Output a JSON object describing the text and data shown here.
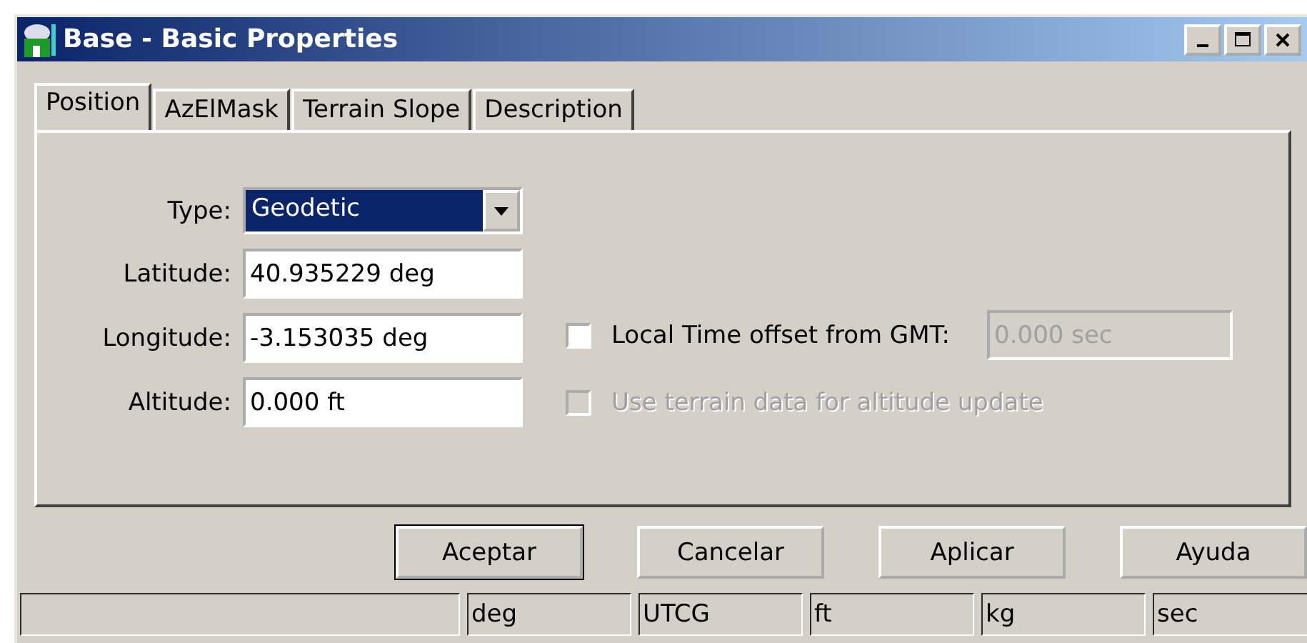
{
  "window": {
    "title": "Base - Basic Properties"
  },
  "tabs": [
    {
      "label": "Position",
      "selected": true
    },
    {
      "label": "AzElMask",
      "selected": false
    },
    {
      "label": "Terrain Slope",
      "selected": false
    },
    {
      "label": "Description",
      "selected": false
    }
  ],
  "fields": [
    {
      "kind": "dropdown",
      "label": "Type:",
      "value": "Geodetic"
    },
    {
      "kind": "text",
      "label": "Latitude:",
      "value": "40.935229 deg"
    },
    {
      "kind": "text",
      "label": "Longitude:",
      "value": "-3.153035 deg"
    },
    {
      "kind": "text",
      "label": "Altitude:",
      "value": "0.000 ft"
    }
  ],
  "local_time": {
    "label": "Local Time offset from GMT:",
    "checked": false,
    "disabled": false,
    "value": "0.000 sec",
    "value_disabled": true
  },
  "terrain": {
    "label": "Use terrain data for altitude update",
    "checked": false,
    "disabled": true
  },
  "buttons": [
    {
      "label": "Aceptar",
      "default": true
    },
    {
      "label": "Cancelar",
      "default": false
    },
    {
      "label": "Aplicar",
      "default": false
    },
    {
      "label": "Ayuda",
      "default": false
    }
  ],
  "status_bar": [
    "deg",
    "UTCG",
    "ft",
    "kg",
    "sec"
  ]
}
